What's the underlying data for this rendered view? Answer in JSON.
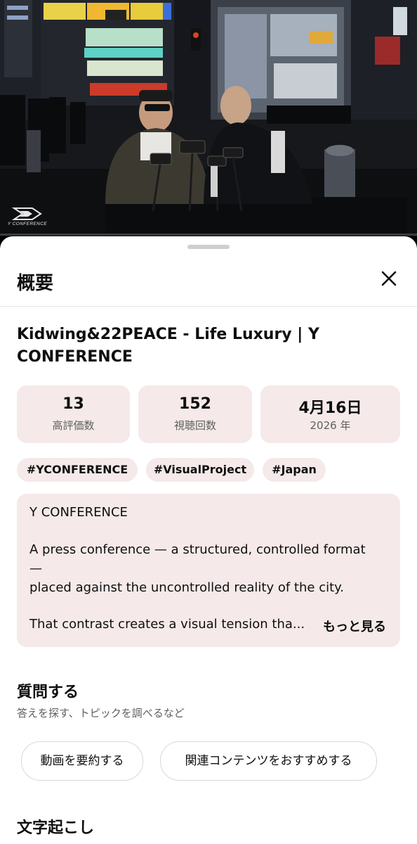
{
  "video": {
    "channel_logo_text": "Y CONFERENCE",
    "icons": [
      "channel-logo-icon"
    ]
  },
  "sheet": {
    "title": "概要",
    "close_icon": "close-icon"
  },
  "video_info": {
    "title": "Kidwing&22PEACE - Life Luxury | Y CONFERENCE",
    "stats": [
      {
        "value": "13",
        "label": "高評価数"
      },
      {
        "value": "152",
        "label": "視聴回数"
      },
      {
        "value": "4月16日",
        "label": "2026 年"
      }
    ],
    "hashtags": [
      "#YCONFERENCE",
      "#VisualProject",
      "#Japan"
    ],
    "description": {
      "lines": [
        "Y CONFERENCE",
        "A press conference — a structured, controlled format",
        "—",
        "placed against the uncontrolled reality of the city.",
        "That contrast creates a visual tension tha..."
      ],
      "more_label": "もっと見る"
    }
  },
  "ask": {
    "title": "質問する",
    "subtitle": "答えを探す、トピックを調べるなど",
    "buttons": [
      "動画を要約する",
      "関連コンテンツをおすすめする"
    ]
  },
  "transcript": {
    "title": "文字起こし"
  },
  "colors": {
    "chip_bg": "#f5e9e9",
    "text": "#0f0f0f",
    "secondary": "#606060"
  }
}
